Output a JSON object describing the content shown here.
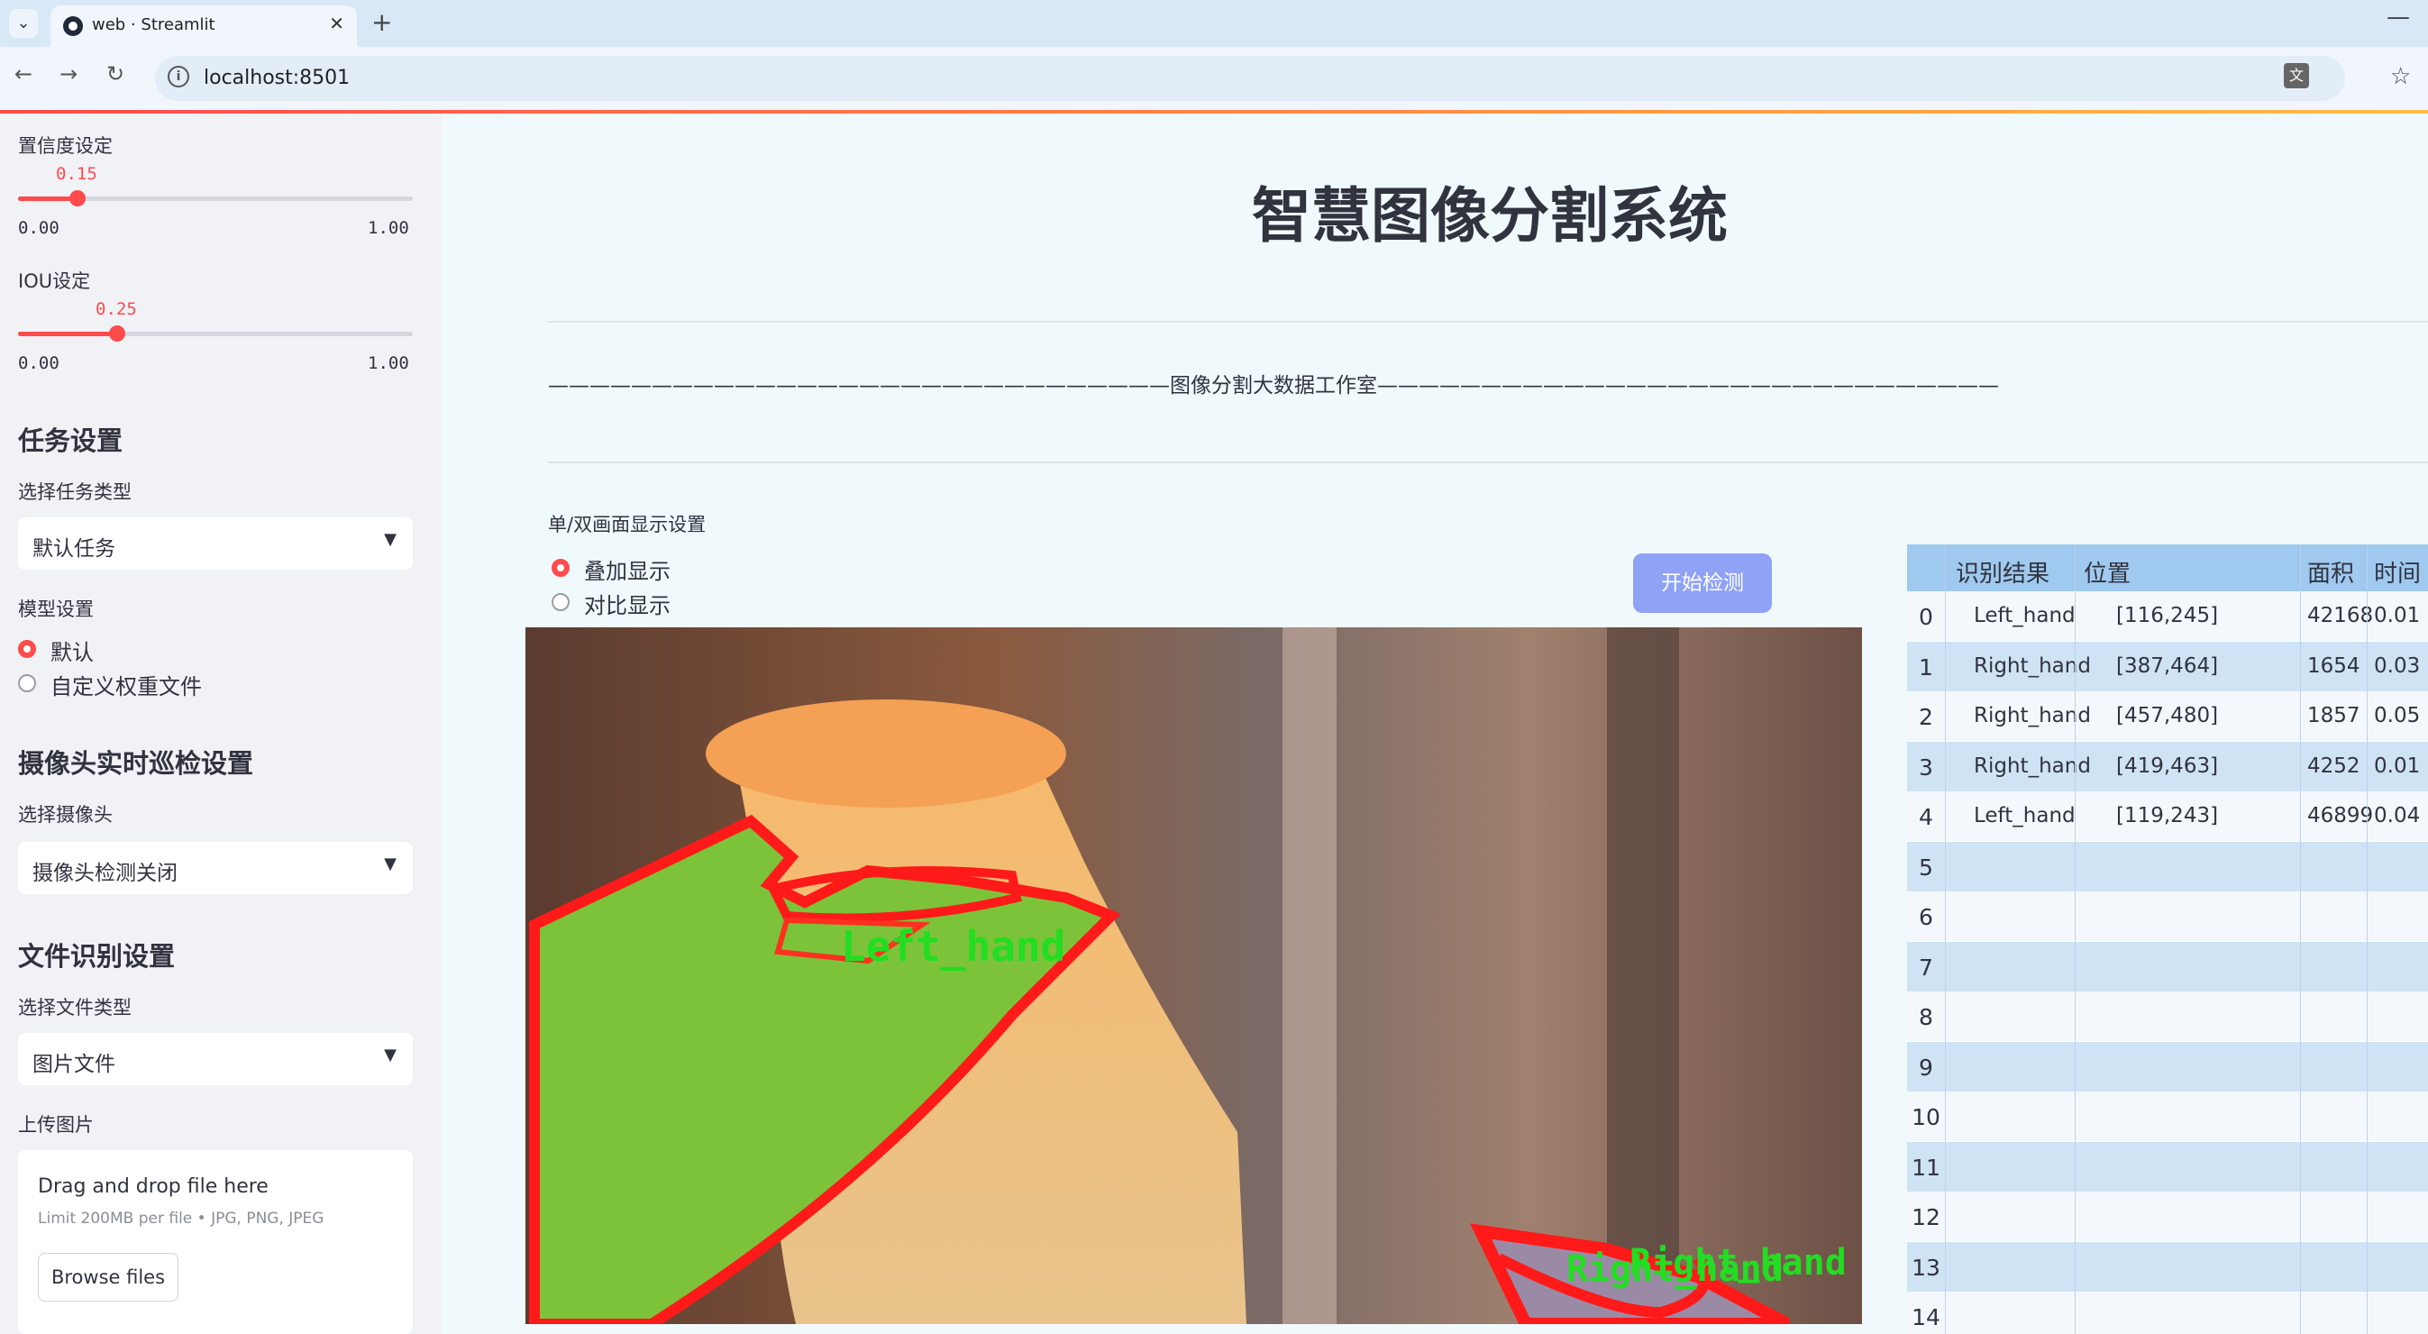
{
  "browser": {
    "tab_title": "web · Streamlit",
    "url": "localhost:8501"
  },
  "sidebar": {
    "confidence": {
      "label": "置信度设定",
      "value": "0.15",
      "value_num": 0.15,
      "min": "0.00",
      "max": "1.00"
    },
    "iou": {
      "label": "IOU设定",
      "value": "0.25",
      "value_num": 0.25,
      "min": "0.00",
      "max": "1.00"
    },
    "task_heading": "任务设置",
    "task_type_label": "选择任务类型",
    "task_type_value": "默认任务",
    "model_label": "模型设置",
    "model_options": [
      "默认",
      "自定义权重文件"
    ],
    "model_selected": 0,
    "camera_heading": "摄像头实时巡检设置",
    "camera_label": "选择摄像头",
    "camera_value": "摄像头检测关闭",
    "file_heading": "文件识别设置",
    "file_type_label": "选择文件类型",
    "file_type_value": "图片文件",
    "upload_label": "上传图片",
    "upload_drag_text": "Drag and drop file here",
    "upload_limit_text": "Limit 200MB per file • JPG, PNG, JPEG",
    "browse_label": "Browse files"
  },
  "main": {
    "title": "智慧图像分割系统",
    "studio_text": "——————————————————————————————图像分割大数据工作室——————————————————————————————",
    "display_mode_label": "单/双画面显示设置",
    "display_options": [
      "叠加显示",
      "对比显示"
    ],
    "display_selected": 0,
    "start_button": "开始检测",
    "overlay_labels": {
      "left": "Left_hand",
      "right": "Right_hand"
    }
  },
  "table": {
    "headers": [
      "识别结果",
      "位置",
      "面积",
      "时间"
    ],
    "rows": [
      {
        "index": "0",
        "result": "Left_hand",
        "position": "[116,245]",
        "area": "42168",
        "time": "0.01"
      },
      {
        "index": "1",
        "result": "Right_hand",
        "position": "[387,464]",
        "area": "1654",
        "time": "0.03"
      },
      {
        "index": "2",
        "result": "Right_hand",
        "position": "[457,480]",
        "area": "1857",
        "time": "0.05"
      },
      {
        "index": "3",
        "result": "Right_hand",
        "position": "[419,463]",
        "area": "4252",
        "time": "0.01"
      },
      {
        "index": "4",
        "result": "Left_hand",
        "position": "[119,243]",
        "area": "46899",
        "time": "0.04"
      },
      {
        "index": "5",
        "result": "",
        "position": "",
        "area": "",
        "time": ""
      },
      {
        "index": "6",
        "result": "",
        "position": "",
        "area": "",
        "time": ""
      },
      {
        "index": "7",
        "result": "",
        "position": "",
        "area": "",
        "time": ""
      },
      {
        "index": "8",
        "result": "",
        "position": "",
        "area": "",
        "time": ""
      },
      {
        "index": "9",
        "result": "",
        "position": "",
        "area": "",
        "time": ""
      },
      {
        "index": "10",
        "result": "",
        "position": "",
        "area": "",
        "time": ""
      },
      {
        "index": "11",
        "result": "",
        "position": "",
        "area": "",
        "time": ""
      },
      {
        "index": "12",
        "result": "",
        "position": "",
        "area": "",
        "time": ""
      },
      {
        "index": "13",
        "result": "",
        "position": "",
        "area": "",
        "time": ""
      },
      {
        "index": "14",
        "result": "",
        "position": "",
        "area": "",
        "time": ""
      }
    ]
  },
  "colors": {
    "accent": "#ff4b4b",
    "button": "#8fa2f5",
    "table_header": "#9fc9ef",
    "table_odd": "#cfe3f5",
    "mask_green": "#7cc33a",
    "mask_outline": "#ff1a1a",
    "label_green": "#22dd22"
  }
}
